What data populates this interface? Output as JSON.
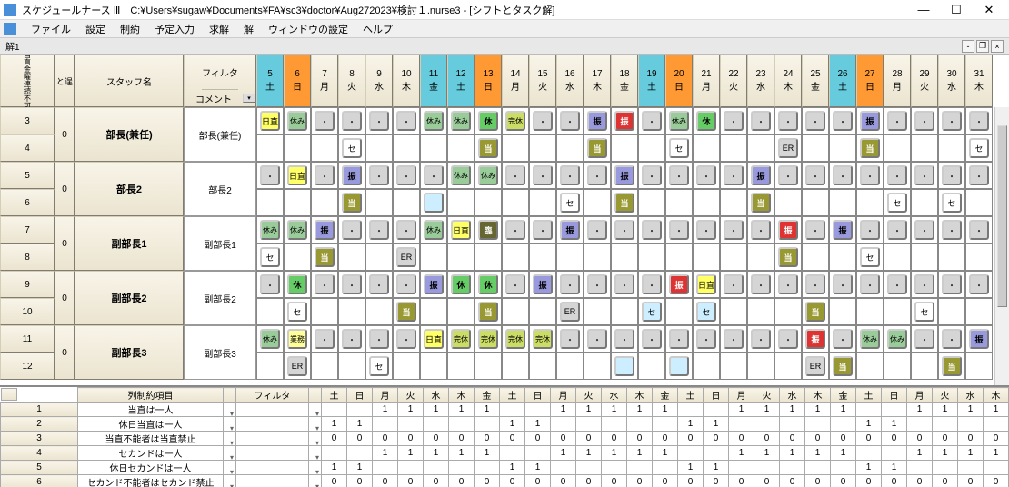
{
  "window": {
    "title": "スケジュールナース Ⅲ　C:¥Users¥sugaw¥Documents¥FA¥sc3¥doctor¥Aug272023¥検討１.nurse3 - [シフトとタスク解]"
  },
  "menu": [
    "ファイル",
    "設定",
    "制約",
    "予定入力",
    "求解",
    "解",
    "ウィンドウの設定",
    "ヘルプ"
  ],
  "tab_label": "解1",
  "headers": {
    "left1": "当直金曜連続不可",
    "left2": "と逞",
    "staff": "スタッフ名",
    "filter": "フィルタ",
    "comment": "コメント"
  },
  "days": [
    {
      "n": "5",
      "w": "土",
      "cls": "day-sat"
    },
    {
      "n": "6",
      "w": "日",
      "cls": "day-sun"
    },
    {
      "n": "7",
      "w": "月",
      "cls": ""
    },
    {
      "n": "8",
      "w": "火",
      "cls": ""
    },
    {
      "n": "9",
      "w": "水",
      "cls": ""
    },
    {
      "n": "10",
      "w": "木",
      "cls": ""
    },
    {
      "n": "11",
      "w": "金",
      "cls": "day-sat"
    },
    {
      "n": "12",
      "w": "土",
      "cls": "day-sat"
    },
    {
      "n": "13",
      "w": "日",
      "cls": "day-sun"
    },
    {
      "n": "14",
      "w": "月",
      "cls": ""
    },
    {
      "n": "15",
      "w": "火",
      "cls": ""
    },
    {
      "n": "16",
      "w": "水",
      "cls": ""
    },
    {
      "n": "17",
      "w": "木",
      "cls": ""
    },
    {
      "n": "18",
      "w": "金",
      "cls": ""
    },
    {
      "n": "19",
      "w": "土",
      "cls": "day-sat"
    },
    {
      "n": "20",
      "w": "日",
      "cls": "day-sun"
    },
    {
      "n": "21",
      "w": "月",
      "cls": ""
    },
    {
      "n": "22",
      "w": "火",
      "cls": ""
    },
    {
      "n": "23",
      "w": "水",
      "cls": ""
    },
    {
      "n": "24",
      "w": "木",
      "cls": ""
    },
    {
      "n": "25",
      "w": "金",
      "cls": ""
    },
    {
      "n": "26",
      "w": "土",
      "cls": "day-sat"
    },
    {
      "n": "27",
      "w": "日",
      "cls": "day-sun"
    },
    {
      "n": "28",
      "w": "月",
      "cls": ""
    },
    {
      "n": "29",
      "w": "火",
      "cls": ""
    },
    {
      "n": "30",
      "w": "水",
      "cls": ""
    },
    {
      "n": "31",
      "w": "木",
      "cls": ""
    }
  ],
  "staff": [
    {
      "rows": [
        "3",
        "4"
      ],
      "count": "0",
      "name": "部長(兼任)",
      "filter": "部長(兼任)",
      "r1": [
        [
          "日直",
          "nichi"
        ],
        [
          "休み",
          "yasumi"
        ],
        [
          "",
          "blank"
        ],
        [
          "",
          "blank"
        ],
        [
          "",
          "blank"
        ],
        [
          "",
          "blank"
        ],
        [
          "休み",
          "yasumi"
        ],
        [
          "休み",
          "yasumi"
        ],
        [
          "休",
          "kyu"
        ],
        [
          "完休",
          "kan"
        ],
        [
          "",
          "blank"
        ],
        [
          "",
          "blank"
        ],
        [
          "振",
          "furi"
        ],
        [
          "振",
          "furi-red"
        ],
        [
          "",
          "blank"
        ],
        [
          "休み",
          "yasumi"
        ],
        [
          "休",
          "kyu"
        ],
        [
          "",
          "blank"
        ],
        [
          "",
          "blank"
        ],
        [
          "",
          "blank"
        ],
        [
          "",
          "blank"
        ],
        [
          "",
          "blank"
        ],
        [
          "振",
          "furi"
        ],
        [
          "",
          "blank"
        ],
        [
          "",
          "blank"
        ],
        [
          "",
          "blank"
        ],
        [
          "",
          "blank"
        ]
      ],
      "r2": [
        [],
        [],
        [],
        [
          "セ",
          "se"
        ],
        [],
        [],
        [],
        [],
        [
          "当",
          "touchoku"
        ],
        [],
        [],
        [],
        [
          "当",
          "touchoku"
        ],
        [],
        [],
        [
          "セ",
          "se"
        ],
        [],
        [],
        [],
        [
          "ER",
          "er"
        ],
        [],
        [],
        [
          "当",
          "touchoku"
        ],
        [],
        [],
        [],
        [
          "セ",
          "se"
        ]
      ]
    },
    {
      "rows": [
        "5",
        "6"
      ],
      "count": "0",
      "name": "部長2",
      "filter": "部長2",
      "r1": [
        [
          "",
          "blank"
        ],
        [
          "日直",
          "nichi"
        ],
        [
          "",
          "blank"
        ],
        [
          "振",
          "furi"
        ],
        [
          "",
          "blank"
        ],
        [
          "",
          "blank"
        ],
        [
          "",
          "blank"
        ],
        [
          "休み",
          "yasumi"
        ],
        [
          "休み",
          "yasumi"
        ],
        [
          "",
          "blank"
        ],
        [
          "",
          "blank"
        ],
        [
          "",
          "blank"
        ],
        [
          "",
          "blank"
        ],
        [
          "振",
          "furi"
        ],
        [
          "",
          "blank"
        ],
        [
          "",
          "blank"
        ],
        [
          "",
          "blank"
        ],
        [
          "",
          "blank"
        ],
        [
          "振",
          "furi"
        ],
        [
          "",
          "blank"
        ],
        [
          "",
          "blank"
        ],
        [
          "",
          "blank"
        ],
        [
          "",
          "blank"
        ],
        [
          "",
          "blank"
        ],
        [
          "",
          "blank"
        ],
        [
          "",
          "blank"
        ],
        [
          "",
          "blank"
        ]
      ],
      "r2": [
        [],
        [],
        [],
        [
          "当",
          "touchoku"
        ],
        [],
        [],
        [
          "",
          "pale"
        ],
        [],
        [],
        [],
        [],
        [
          "セ",
          "se"
        ],
        [],
        [
          "当",
          "touchoku"
        ],
        [],
        [],
        [],
        [],
        [
          "当",
          "touchoku"
        ],
        [],
        [],
        [],
        [],
        [
          "セ",
          "se"
        ],
        [],
        [
          "セ",
          "se"
        ],
        []
      ]
    },
    {
      "rows": [
        "7",
        "8"
      ],
      "count": "0",
      "name": "副部長1",
      "filter": "副部長1",
      "r1": [
        [
          "休み",
          "yasumi"
        ],
        [
          "休み",
          "yasumi"
        ],
        [
          "振",
          "furi"
        ],
        [
          "",
          "blank"
        ],
        [
          "",
          "blank"
        ],
        [
          "",
          "blank"
        ],
        [
          "休み",
          "yasumi"
        ],
        [
          "日直",
          "nichi"
        ],
        [
          "臨",
          "rin"
        ],
        [
          "",
          "blank"
        ],
        [
          "",
          "blank"
        ],
        [
          "振",
          "furi"
        ],
        [
          "",
          "blank"
        ],
        [
          "",
          "blank"
        ],
        [
          "",
          "blank"
        ],
        [
          "",
          "blank"
        ],
        [
          "",
          "blank"
        ],
        [
          "",
          "blank"
        ],
        [
          "",
          "blank"
        ],
        [
          "振",
          "furi-red"
        ],
        [
          "",
          "blank"
        ],
        [
          "振",
          "furi"
        ],
        [
          "",
          "blank"
        ],
        [
          "",
          "blank"
        ],
        [
          "",
          "blank"
        ],
        [
          "",
          "blank"
        ],
        [
          "",
          "blank"
        ]
      ],
      "r2": [
        [
          "セ",
          "se"
        ],
        [],
        [
          "当",
          "touchoku"
        ],
        [],
        [],
        [
          "ER",
          "er"
        ],
        [],
        [],
        [],
        [],
        [],
        [],
        [],
        [],
        [],
        [],
        [],
        [],
        [],
        [
          "当",
          "touchoku"
        ],
        [],
        [],
        [
          "セ",
          "se"
        ],
        [],
        [],
        [],
        []
      ]
    },
    {
      "rows": [
        "9",
        "10"
      ],
      "count": "0",
      "name": "副部長2",
      "filter": "副部長2",
      "r1": [
        [
          "",
          "blank"
        ],
        [
          "休",
          "kyu"
        ],
        [
          "",
          "blank"
        ],
        [
          "",
          "blank"
        ],
        [
          "",
          "blank"
        ],
        [
          "",
          "blank"
        ],
        [
          "振",
          "furi"
        ],
        [
          "休",
          "kyu"
        ],
        [
          "休",
          "kyu"
        ],
        [
          "",
          "blank"
        ],
        [
          "振",
          "furi"
        ],
        [
          "",
          "blank"
        ],
        [
          "",
          "blank"
        ],
        [
          "",
          "blank"
        ],
        [
          "",
          "blank"
        ],
        [
          "振",
          "furi-red"
        ],
        [
          "日直",
          "nichi"
        ],
        [
          "",
          "blank"
        ],
        [
          "",
          "blank"
        ],
        [
          "",
          "blank"
        ],
        [
          "",
          "blank"
        ],
        [
          "",
          "blank"
        ],
        [
          "",
          "blank"
        ],
        [
          "",
          "blank"
        ],
        [
          "",
          "blank"
        ],
        [
          "",
          "blank"
        ],
        [
          "",
          "blank"
        ]
      ],
      "r2": [
        [],
        [
          "セ",
          "se"
        ],
        [],
        [],
        [],
        [
          "当",
          "touchoku"
        ],
        [],
        [],
        [
          "当",
          "touchoku"
        ],
        [],
        [],
        [
          "ER",
          "er"
        ],
        [],
        [],
        [
          "セ",
          "se-blue"
        ],
        [],
        [
          "セ",
          "se-blue"
        ],
        [],
        [],
        [],
        [
          "当",
          "touchoku"
        ],
        [],
        [],
        [],
        [
          "セ",
          "se"
        ],
        [],
        []
      ]
    },
    {
      "rows": [
        "11",
        "12"
      ],
      "count": "0",
      "name": "副部長3",
      "filter": "副部長3",
      "r1": [
        [
          "休み",
          "yasumi"
        ],
        [
          "業務",
          "gyou"
        ],
        [
          "",
          "blank"
        ],
        [
          "",
          "blank"
        ],
        [
          "",
          "blank"
        ],
        [
          "",
          "blank"
        ],
        [
          "日直",
          "nichi"
        ],
        [
          "完休",
          "kan"
        ],
        [
          "完休",
          "kan"
        ],
        [
          "完休",
          "kan"
        ],
        [
          "完休",
          "kan"
        ],
        [
          "",
          "blank"
        ],
        [
          "",
          "blank"
        ],
        [
          "",
          "blank"
        ],
        [
          "",
          "blank"
        ],
        [
          "",
          "blank"
        ],
        [
          "",
          "blank"
        ],
        [
          "",
          "blank"
        ],
        [
          "",
          "blank"
        ],
        [
          "",
          "blank"
        ],
        [
          "振",
          "furi-red"
        ],
        [
          "",
          "blank"
        ],
        [
          "休み",
          "yasumi"
        ],
        [
          "休み",
          "yasumi"
        ],
        [
          "",
          "blank"
        ],
        [
          "",
          "blank"
        ],
        [
          "振",
          "furi"
        ]
      ],
      "r2": [
        [],
        [
          "ER",
          "er"
        ],
        [],
        [],
        [
          "セ",
          "se"
        ],
        [],
        [],
        [],
        [],
        [],
        [],
        [],
        [],
        [
          "",
          "se-blue"
        ],
        [],
        [
          "",
          "se-blue"
        ],
        [],
        [],
        [],
        [],
        [
          "ER",
          "er"
        ],
        [
          "当",
          "touchoku"
        ],
        [],
        [],
        [],
        [
          "当",
          "touchoku"
        ],
        []
      ]
    }
  ],
  "constraints": {
    "header": {
      "name": "列制約項目",
      "filter": "フィルタ",
      "days": [
        "土",
        "日",
        "月",
        "火",
        "水",
        "木",
        "金",
        "土",
        "日",
        "月",
        "火",
        "水",
        "木",
        "金",
        "土",
        "日",
        "月",
        "火",
        "水",
        "木",
        "金",
        "土",
        "日",
        "月",
        "火",
        "水",
        "木"
      ]
    },
    "rows": [
      {
        "n": "1",
        "name": "当直は一人",
        "v": [
          "",
          "",
          "1",
          "1",
          "1",
          "1",
          "1",
          "",
          "",
          "1",
          "1",
          "1",
          "1",
          "1",
          "",
          "",
          "1",
          "1",
          "1",
          "1",
          "1",
          "",
          "",
          "1",
          "1",
          "1",
          "1"
        ]
      },
      {
        "n": "2",
        "name": "休日当直は一人",
        "v": [
          "1",
          "1",
          "",
          "",
          "",
          "",
          "",
          "1",
          "1",
          "",
          "",
          "",
          "",
          "",
          "1",
          "1",
          "",
          "",
          "",
          "",
          "",
          "1",
          "1",
          "",
          "",
          "",
          ""
        ]
      },
      {
        "n": "3",
        "name": "当直不能者は当直禁止",
        "v": [
          "0",
          "0",
          "0",
          "0",
          "0",
          "0",
          "0",
          "0",
          "0",
          "0",
          "0",
          "0",
          "0",
          "0",
          "0",
          "0",
          "0",
          "0",
          "0",
          "0",
          "0",
          "0",
          "0",
          "0",
          "0",
          "0",
          "0"
        ]
      },
      {
        "n": "4",
        "name": "セカンドは一人",
        "v": [
          "",
          "",
          "1",
          "1",
          "1",
          "1",
          "1",
          "",
          "",
          "1",
          "1",
          "1",
          "1",
          "1",
          "",
          "",
          "1",
          "1",
          "1",
          "1",
          "1",
          "",
          "",
          "1",
          "1",
          "1",
          "1"
        ]
      },
      {
        "n": "5",
        "name": "休日セカンドは一人",
        "v": [
          "1",
          "1",
          "",
          "",
          "",
          "",
          "",
          "1",
          "1",
          "",
          "",
          "",
          "",
          "",
          "1",
          "1",
          "",
          "",
          "",
          "",
          "",
          "1",
          "1",
          "",
          "",
          "",
          ""
        ]
      },
      {
        "n": "6",
        "name": "セカンド不能者はセカンド禁止",
        "v": [
          "0",
          "0",
          "0",
          "0",
          "0",
          "0",
          "0",
          "0",
          "0",
          "0",
          "0",
          "0",
          "0",
          "0",
          "0",
          "0",
          "0",
          "0",
          "0",
          "0",
          "0",
          "0",
          "0",
          "0",
          "0",
          "0",
          "0"
        ]
      }
    ]
  }
}
